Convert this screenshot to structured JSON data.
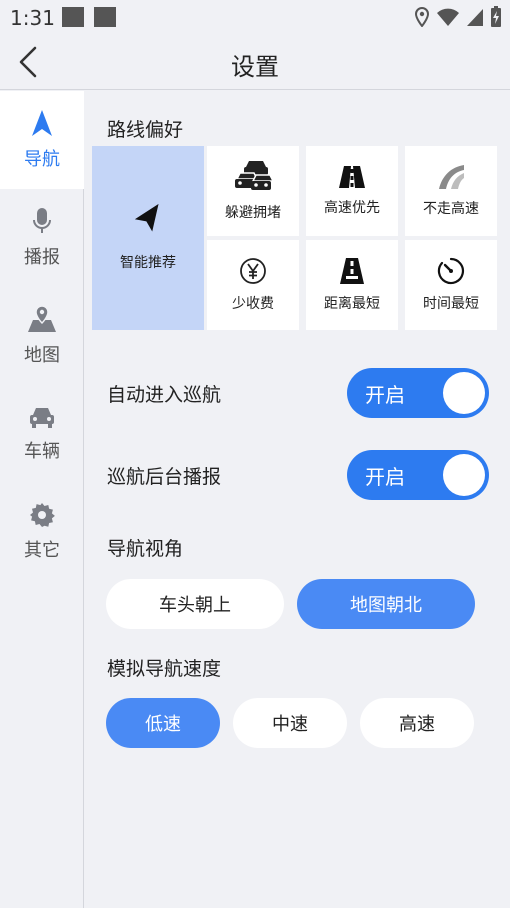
{
  "status_bar": {
    "time": "1:31"
  },
  "header": {
    "title": "设置"
  },
  "sidebar": {
    "items": [
      {
        "label": "导航",
        "icon": "navigation-arrow-icon",
        "active": true
      },
      {
        "label": "播报",
        "icon": "microphone-icon",
        "active": false
      },
      {
        "label": "地图",
        "icon": "map-pin-icon",
        "active": false
      },
      {
        "label": "车辆",
        "icon": "car-icon",
        "active": false
      },
      {
        "label": "其它",
        "icon": "gear-icon",
        "active": false
      }
    ]
  },
  "route_pref": {
    "title": "路线偏好",
    "smart": {
      "label": "智能推荐",
      "icon": "navigation-cursor-icon",
      "selected": true
    },
    "options": [
      {
        "label": "躲避拥堵",
        "icon": "traffic-cars-icon"
      },
      {
        "label": "高速优先",
        "icon": "highway-icon"
      },
      {
        "label": "不走高速",
        "icon": "no-highway-icon"
      },
      {
        "label": "少收费",
        "icon": "yen-coin-icon"
      },
      {
        "label": "距离最短",
        "icon": "road-distance-icon"
      },
      {
        "label": "时间最短",
        "icon": "timer-icon"
      }
    ]
  },
  "auto_cruise": {
    "label": "自动进入巡航",
    "toggle_text": "开启",
    "on": true
  },
  "cruise_bg": {
    "label": "巡航后台播报",
    "toggle_text": "开启",
    "on": true
  },
  "nav_view": {
    "title": "导航视角",
    "options": [
      {
        "label": "车头朝上",
        "selected": false
      },
      {
        "label": "地图朝北",
        "selected": true
      }
    ]
  },
  "sim_speed": {
    "title": "模拟导航速度",
    "options": [
      {
        "label": "低速",
        "selected": true
      },
      {
        "label": "中速",
        "selected": false
      },
      {
        "label": "高速",
        "selected": false
      }
    ]
  },
  "colors": {
    "accent": "#2d7bf0",
    "selected_pill": "#4a8af4",
    "selected_tile": "#c4d5f7"
  }
}
